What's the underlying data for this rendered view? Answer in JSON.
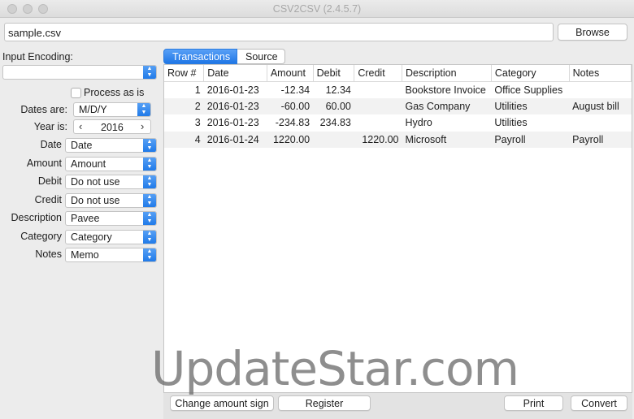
{
  "window": {
    "title": "CSV2CSV (2.4.5.7)"
  },
  "file": {
    "value": "sample.csv",
    "browse_label": "Browse"
  },
  "left_panel": {
    "input_encoding_label": "Input Encoding:",
    "input_encoding_value": "",
    "process_as_is_label": "Process as is",
    "dates_are_label": "Dates are:",
    "dates_are_value": "M/D/Y",
    "year_is_label": "Year is:",
    "year_value": "2016",
    "fields": [
      {
        "label": "Date",
        "value": "Date"
      },
      {
        "label": "Amount",
        "value": "Amount"
      },
      {
        "label": "Debit",
        "value": "Do not use"
      },
      {
        "label": "Credit",
        "value": "Do not use"
      },
      {
        "label": "Description",
        "value": "Pavee"
      },
      {
        "label": "Category",
        "value": "Category"
      },
      {
        "label": "Notes",
        "value": "Memo"
      }
    ]
  },
  "tabs": [
    {
      "label": "Transactions",
      "active": true
    },
    {
      "label": "Source",
      "active": false
    }
  ],
  "table": {
    "headers": [
      "Row #",
      "Date",
      "Amount",
      "Debit",
      "Credit",
      "Description",
      "Category",
      "Notes"
    ],
    "rows": [
      [
        "1",
        "2016-01-23",
        "-12.34",
        "12.34",
        "",
        "Bookstore Invoice",
        "Office Supplies",
        ""
      ],
      [
        "2",
        "2016-01-23",
        "-60.00",
        "60.00",
        "",
        "Gas Company",
        "Utilities",
        "August bill"
      ],
      [
        "3",
        "2016-01-23",
        "-234.83",
        "234.83",
        "",
        "Hydro",
        "Utilities",
        ""
      ],
      [
        "4",
        "2016-01-24",
        "1220.00",
        "",
        "1220.00",
        "Microsoft",
        "Payroll",
        "Payroll"
      ]
    ]
  },
  "footer": {
    "change_amount_sign_label": "Change amount sign",
    "register_label": "Register",
    "print_label": "Print",
    "convert_label": "Convert"
  },
  "watermark": "UpdateStar.com",
  "colors": {
    "accent": "#1f76e6"
  }
}
